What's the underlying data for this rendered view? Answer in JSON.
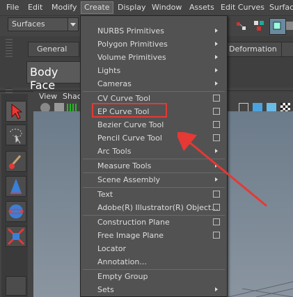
{
  "menubar": {
    "items": [
      "File",
      "Edit",
      "Modify",
      "Create",
      "Display",
      "Window",
      "Assets",
      "Edit Curves",
      "Surface"
    ],
    "active": "Create"
  },
  "shelf": {
    "menuset": "Surfaces",
    "tab_general": "General",
    "tab_deformation": "Deformation"
  },
  "channel": {
    "object_name": "Body Face"
  },
  "viewport": {
    "menu_view": "View",
    "menu_shading_partial": "Shac"
  },
  "create_menu": {
    "items": [
      {
        "label": "NURBS Primitives",
        "submenu": true
      },
      {
        "label": "Polygon Primitives",
        "submenu": true
      },
      {
        "label": "Volume Primitives",
        "submenu": true
      },
      {
        "label": "Lights",
        "submenu": true
      },
      {
        "label": "Cameras",
        "submenu": true
      },
      {
        "label": "CV Curve Tool",
        "option": true
      },
      {
        "label": "EP Curve Tool",
        "option": true
      },
      {
        "label": "Bezier Curve Tool",
        "option": true
      },
      {
        "label": "Pencil Curve Tool",
        "option": true
      },
      {
        "label": "Arc Tools",
        "submenu": true
      },
      {
        "label": "Measure Tools",
        "submenu": true
      },
      {
        "label": "Scene Assembly",
        "submenu": true
      },
      {
        "label": "Text",
        "option": true
      },
      {
        "label": "Adobe(R) Illustrator(R) Object...",
        "option": true
      },
      {
        "label": "Construction Plane",
        "option": true
      },
      {
        "label": "Free Image Plane",
        "option": true
      },
      {
        "label": "Locator"
      },
      {
        "label": "Annotation..."
      },
      {
        "label": "Empty Group"
      },
      {
        "label": "Sets",
        "submenu": true
      }
    ],
    "highlighted": "EP Curve Tool"
  },
  "colors": {
    "highlight_box": "#e53935",
    "annotation_arrow": "#e53935"
  }
}
